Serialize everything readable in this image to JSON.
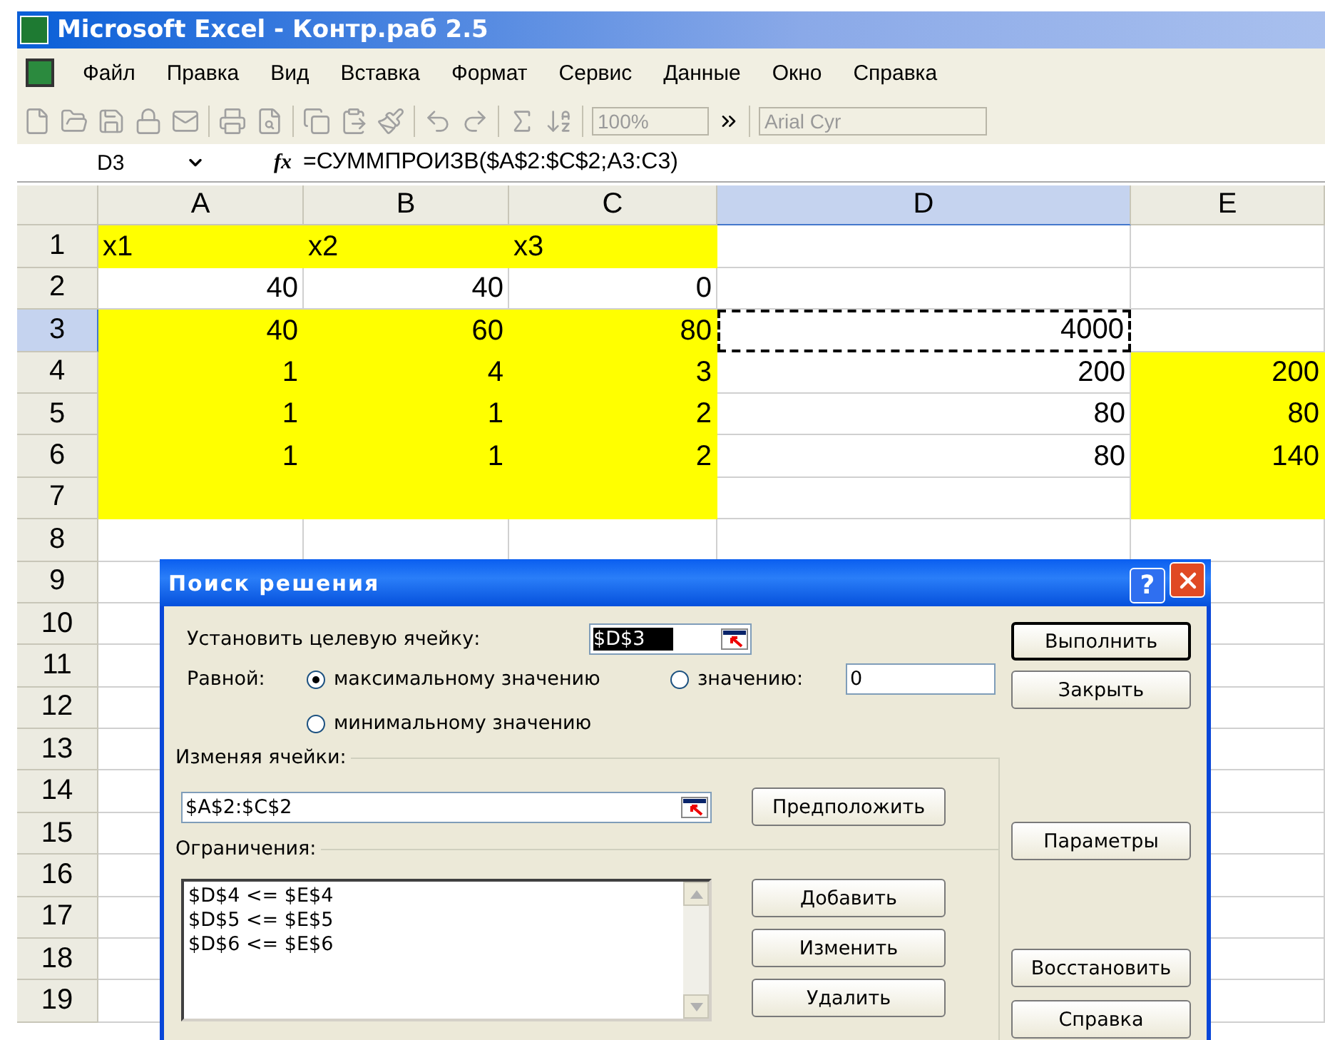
{
  "window": {
    "title": "Microsoft Excel - Контр.раб 2.5"
  },
  "menu": [
    "Файл",
    "Правка",
    "Вид",
    "Вставка",
    "Формат",
    "Сервис",
    "Данные",
    "Окно",
    "Справка"
  ],
  "toolbar": {
    "zoom": "100%",
    "font": "Arial Cyr"
  },
  "formula_bar": {
    "cell": "D3",
    "function_label": "fx",
    "formula": "=СУММПРОИЗВ($A$2:$C$2;A3:C3)"
  },
  "columns": [
    {
      "label": "A",
      "selected": false
    },
    {
      "label": "B",
      "selected": false
    },
    {
      "label": "C",
      "selected": false
    },
    {
      "label": "D",
      "selected": true
    },
    {
      "label": "E",
      "selected": false
    }
  ],
  "rows": [
    {
      "header": "1",
      "selected": false,
      "cells": [
        {
          "text": "x1",
          "kind": "text",
          "highlighted": true
        },
        {
          "text": "x2",
          "kind": "text",
          "highlighted": true
        },
        {
          "text": "x3",
          "kind": "text",
          "highlighted": true
        },
        {
          "highlighted": false
        },
        {
          "highlighted": false
        }
      ]
    },
    {
      "header": "2",
      "selected": false,
      "cells": [
        {
          "text": "40",
          "highlighted": false
        },
        {
          "text": "40",
          "highlighted": false
        },
        {
          "text": "0",
          "highlighted": false
        },
        {
          "highlighted": false
        },
        {
          "highlighted": false
        }
      ]
    },
    {
      "header": "3",
      "selected": true,
      "cells": [
        {
          "text": "40",
          "highlighted": true
        },
        {
          "text": "60",
          "highlighted": true
        },
        {
          "text": "80",
          "highlighted": true
        },
        {
          "text": "4000",
          "highlighted": false,
          "active": true
        },
        {
          "highlighted": false
        }
      ]
    },
    {
      "header": "4",
      "selected": false,
      "cells": [
        {
          "text": "1",
          "highlighted": true
        },
        {
          "text": "4",
          "highlighted": true
        },
        {
          "text": "3",
          "highlighted": true
        },
        {
          "text": "200",
          "highlighted": false
        },
        {
          "text": "200",
          "highlighted": true
        }
      ]
    },
    {
      "header": "5",
      "selected": false,
      "cells": [
        {
          "text": "1",
          "highlighted": true
        },
        {
          "text": "1",
          "highlighted": true
        },
        {
          "text": "2",
          "highlighted": true
        },
        {
          "text": "80",
          "highlighted": false
        },
        {
          "text": "80",
          "highlighted": true
        }
      ]
    },
    {
      "header": "6",
      "selected": false,
      "cells": [
        {
          "text": "1",
          "highlighted": true
        },
        {
          "text": "1",
          "highlighted": true
        },
        {
          "text": "2",
          "highlighted": true
        },
        {
          "text": "80",
          "highlighted": false
        },
        {
          "text": "140",
          "highlighted": true
        }
      ]
    },
    {
      "header": "7",
      "selected": false,
      "cells": [
        {
          "highlighted": true
        },
        {
          "highlighted": true
        },
        {
          "highlighted": true
        },
        {
          "highlighted": false
        },
        {
          "highlighted": true
        }
      ]
    },
    {
      "header": "8",
      "selected": false
    },
    {
      "header": "9",
      "selected": false
    },
    {
      "header": "10",
      "selected": false
    },
    {
      "header": "11",
      "selected": false
    },
    {
      "header": "12",
      "selected": false
    },
    {
      "header": "13",
      "selected": false
    },
    {
      "header": "14",
      "selected": false
    },
    {
      "header": "15",
      "selected": false
    },
    {
      "header": "16",
      "selected": false
    },
    {
      "header": "17",
      "selected": false
    },
    {
      "header": "18",
      "selected": false
    },
    {
      "header": "19",
      "selected": false
    }
  ],
  "dialog": {
    "title": "Поиск решения",
    "help": "?",
    "target_label": "Установить целевую ячейку:",
    "target_value": "$D$3",
    "equal_label": "Равной:",
    "options": [
      {
        "label": "максимальному значению",
        "selected": true
      },
      {
        "label": "значению:",
        "selected": false
      },
      {
        "label": "минимальному значению",
        "selected": false
      }
    ],
    "value": "0",
    "changing_label": "Изменяя ячейки:",
    "changing_value": "$A$2:$C$2",
    "guess_button": "Предположить",
    "constraints_label": "Ограничения:",
    "constraints": [
      "$D$4 <= $E$4",
      "$D$5 <= $E$5",
      "$D$6 <= $E$6"
    ],
    "constraint_buttons": [
      "Добавить",
      "Изменить",
      "Удалить"
    ],
    "side_buttons": [
      {
        "label": "Выполнить",
        "default": true
      },
      {
        "label": "Закрыть",
        "default": false
      },
      {
        "label": "Параметры",
        "default": false
      },
      {
        "label": "Восстановить",
        "default": false
      },
      {
        "label": "Справка",
        "default": false
      }
    ]
  }
}
